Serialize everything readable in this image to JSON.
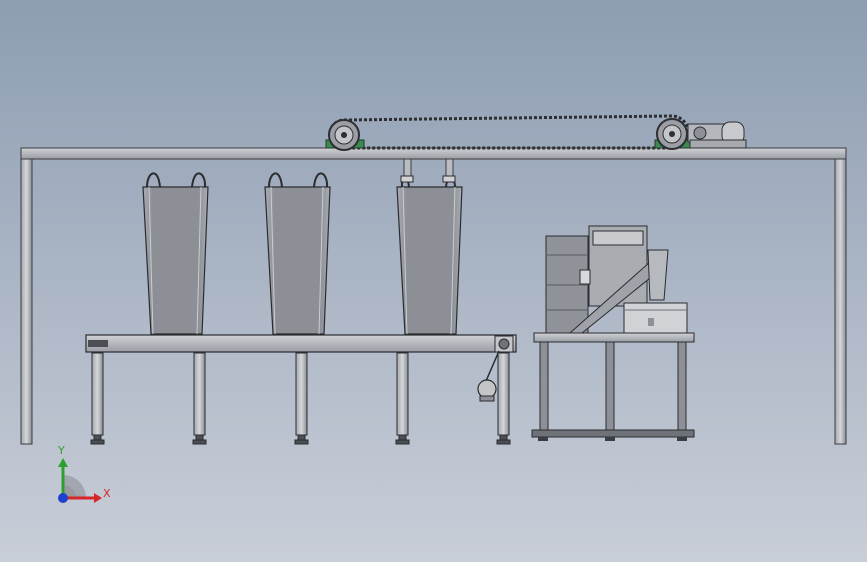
{
  "axis_triad": {
    "y_label": "Y",
    "x_label": "X",
    "y_color": "#2ca02c",
    "x_color": "#d62728",
    "origin_color": "#1f3fcf"
  },
  "parts": {
    "overhead_beam": "overhead-beam",
    "bags": 3,
    "table_legs": 5,
    "sealer_stand_legs": 3
  },
  "colors": {
    "bg_top": "#8f9fb3",
    "bg_bottom": "#c6ccd6",
    "steel_light": "#b9bcc1",
    "steel_mid": "#8d9096",
    "steel_dark": "#55585d",
    "bag_fill": "#8e9197",
    "green_mount": "#3b8a4f",
    "outline": "#2a2c30"
  }
}
